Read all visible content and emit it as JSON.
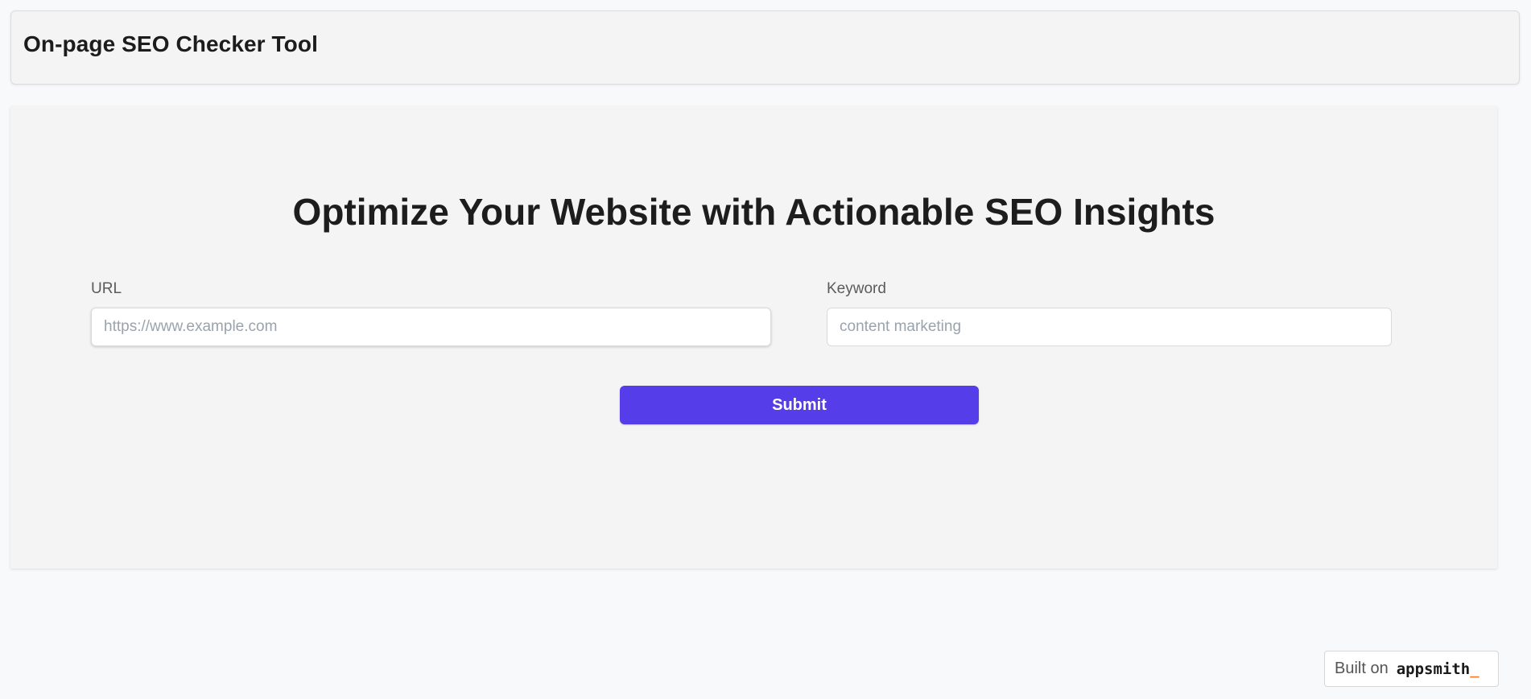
{
  "header": {
    "title": "On-page SEO Checker Tool"
  },
  "main": {
    "heading": "Optimize Your Website with Actionable SEO Insights",
    "url_field": {
      "label": "URL",
      "value": "",
      "placeholder": "https://www.example.com"
    },
    "keyword_field": {
      "label": "Keyword",
      "value": "",
      "placeholder": "content marketing"
    },
    "submit_label": "Submit"
  },
  "footer_badge": {
    "prefix": "Built on",
    "brand": "appsmith",
    "cursor": "_"
  },
  "colors": {
    "accent": "#553de9",
    "brand_cursor": "#f7812b",
    "page_background": "#f8f9fb",
    "panel_background": "#f4f4f4"
  }
}
